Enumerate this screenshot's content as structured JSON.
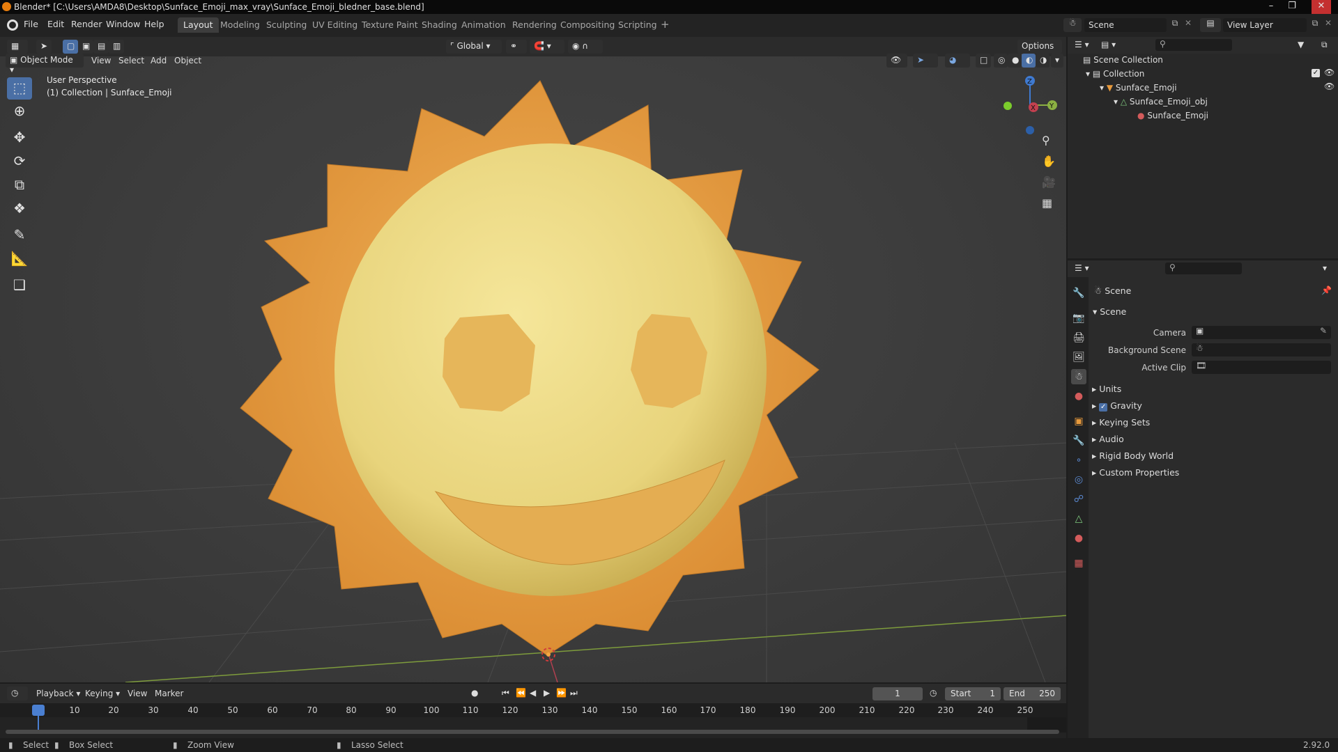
{
  "window": {
    "title": "Blender* [C:\\Users\\AMDA8\\Desktop\\Sunface_Emoji_max_vray\\Sunface_Emoji_bledner_base.blend]"
  },
  "menu": [
    "File",
    "Edit",
    "Render",
    "Window",
    "Help"
  ],
  "workspaces": [
    "Layout",
    "Modeling",
    "Sculpting",
    "UV Editing",
    "Texture Paint",
    "Shading",
    "Animation",
    "Rendering",
    "Compositing",
    "Scripting"
  ],
  "active_workspace": "Layout",
  "scene_selector": "Scene",
  "view_layer_selector": "View Layer",
  "viewport": {
    "mode": "Object Mode",
    "menus": [
      "View",
      "Select",
      "Add",
      "Object"
    ],
    "transform_orientation": "Global",
    "options_label": "Options",
    "overlay_line1": "User Perspective",
    "overlay_line2": "(1) Collection | Sunface_Emoji",
    "gizmo_axes": [
      "Z",
      "X",
      "Y"
    ]
  },
  "outliner": {
    "items": [
      {
        "label": "Scene Collection",
        "icon": "collection-icon"
      },
      {
        "label": "Collection",
        "icon": "collection-icon"
      },
      {
        "label": "Sunface_Emoji",
        "icon": "object-icon"
      },
      {
        "label": "Sunface_Emoji_obj",
        "icon": "mesh-icon"
      },
      {
        "label": "Sunface_Emoji",
        "icon": "material-icon"
      }
    ]
  },
  "properties": {
    "context": "Scene",
    "panel_title": "Scene",
    "fields": [
      {
        "label": "Camera"
      },
      {
        "label": "Background Scene"
      },
      {
        "label": "Active Clip"
      }
    ],
    "subpanels": [
      "Units",
      "Gravity",
      "Keying Sets",
      "Audio",
      "Rigid Body World",
      "Custom Properties"
    ],
    "gravity_checked": true
  },
  "timeline": {
    "menus": [
      "Playback",
      "Keying",
      "View",
      "Marker"
    ],
    "current_frame": "1",
    "start_label": "Start",
    "start_value": "1",
    "end_label": "End",
    "end_value": "250",
    "ticks": [
      "1",
      "10",
      "20",
      "30",
      "40",
      "50",
      "60",
      "70",
      "80",
      "90",
      "100",
      "110",
      "120",
      "130",
      "140",
      "150",
      "160",
      "170",
      "180",
      "190",
      "200",
      "210",
      "220",
      "230",
      "240",
      "250"
    ]
  },
  "statusbar": {
    "select": "Select",
    "box_select": "Box Select",
    "zoom_view": "Zoom View",
    "lasso_select": "Lasso Select",
    "version": "2.92.0"
  },
  "colors": {
    "accent": "#4a6fa5",
    "sun_face": "#e8d47c",
    "sun_rays": "#e9a24a",
    "x_axis": "#c2404f",
    "y_axis": "#8bb042",
    "z_axis": "#3f7ad1"
  }
}
